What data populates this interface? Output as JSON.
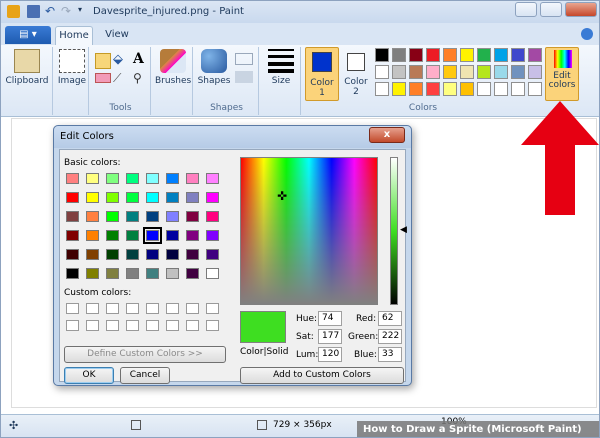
{
  "window": {
    "title": "Davesprite_injured.png - Paint"
  },
  "ribbon": {
    "file_label": "▤ ▾",
    "tabs": [
      "Home",
      "View"
    ],
    "clipboard_label": "Clipboard",
    "image_label": "Image",
    "tools_group": "Tools",
    "brushes_label": "Brushes",
    "shapes_label": "Shapes",
    "shapes_group": "Shapes",
    "size_label": "Size",
    "color1_label": "Color 1",
    "color2_label": "Color 2",
    "colors_group": "Colors",
    "edit_colors_label": "Edit colors",
    "color1_value": "#0033cc",
    "color2_value": "#ffffff",
    "palette_row1": [
      "#000000",
      "#7f7f7f",
      "#880015",
      "#ed1c24",
      "#ff7f27",
      "#fff200",
      "#22b14c",
      "#00a2e8",
      "#3f48cc",
      "#a349a4"
    ],
    "palette_row2": [
      "#ffffff",
      "#c3c3c3",
      "#b97a57",
      "#ffaec9",
      "#ffc90e",
      "#efe4b0",
      "#b5e61d",
      "#99d9ea",
      "#7092be",
      "#c8bfe7"
    ],
    "palette_row3": [
      "#ffffff",
      "#fff200",
      "#ff7f27",
      "#ff4040",
      "#ffff80",
      "#ffc000",
      "#ffffff",
      "#ffffff",
      "#ffffff",
      "#ffffff"
    ]
  },
  "dialog": {
    "title": "Edit Colors",
    "close_label": "x",
    "basic_colors_label": "Basic colors:",
    "custom_colors_label": "Custom colors:",
    "define_custom_label": "Define Custom Colors >>",
    "ok_label": "OK",
    "cancel_label": "Cancel",
    "add_custom_label": "Add to Custom Colors",
    "color_solid_label": "Color|Solid",
    "hue_label": "Hue:",
    "hue": "74",
    "sat_label": "Sat:",
    "sat": "177",
    "lum_label": "Lum:",
    "lum": "120",
    "red_label": "Red:",
    "red": "62",
    "green_label": "Green:",
    "green": "222",
    "blue_label": "Blue:",
    "blue": "33",
    "preview_color": "#3ede21",
    "selected_basic": "#0000ff",
    "basic_colors": [
      [
        "#ff8080",
        "#ffff80",
        "#80ff80",
        "#00ff80",
        "#80ffff",
        "#0080ff",
        "#ff80c0",
        "#ff80ff"
      ],
      [
        "#ff0000",
        "#ffff00",
        "#80ff00",
        "#00ff40",
        "#00ffff",
        "#0080c0",
        "#8080c0",
        "#ff00ff"
      ],
      [
        "#804040",
        "#ff8040",
        "#00ff00",
        "#008080",
        "#004080",
        "#8080ff",
        "#800040",
        "#ff0080"
      ],
      [
        "#800000",
        "#ff8000",
        "#008000",
        "#008040",
        "#0000ff",
        "#0000a0",
        "#800080",
        "#8000ff"
      ],
      [
        "#400000",
        "#804000",
        "#004000",
        "#004040",
        "#000080",
        "#000040",
        "#400040",
        "#400080"
      ],
      [
        "#000000",
        "#808000",
        "#808040",
        "#808080",
        "#408080",
        "#c0c0c0",
        "#400040",
        "#ffffff"
      ]
    ]
  },
  "status": {
    "dimensions": "729 × 356px",
    "zoom": "100%"
  },
  "watermark": {
    "text": "How to Draw a Sprite (Microsoft Paint)"
  }
}
